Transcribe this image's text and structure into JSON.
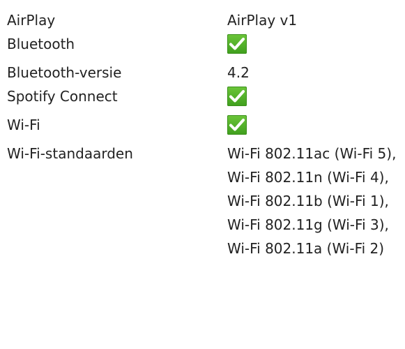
{
  "specs": {
    "rows": [
      {
        "label": "AirPlay",
        "value": "AirPlay v1"
      },
      {
        "label": "Bluetooth",
        "icon": "check-icon"
      },
      {
        "label": "Bluetooth-versie",
        "value": "4.2"
      },
      {
        "label": "Spotify Connect",
        "icon": "check-icon"
      },
      {
        "label": "Wi-Fi",
        "icon": "check-icon"
      },
      {
        "label": "Wi-Fi-standaarden",
        "value": "Wi-Fi 802.11ac (Wi-Fi 5), Wi-Fi 802.11n (Wi-Fi 4), Wi-Fi 802.11b (Wi-Fi 1), Wi-Fi 802.11g (Wi-Fi 3), Wi-Fi 802.11a (Wi-Fi 2)"
      }
    ]
  },
  "colors": {
    "text": "#222222",
    "check_green": "#4caf22"
  }
}
